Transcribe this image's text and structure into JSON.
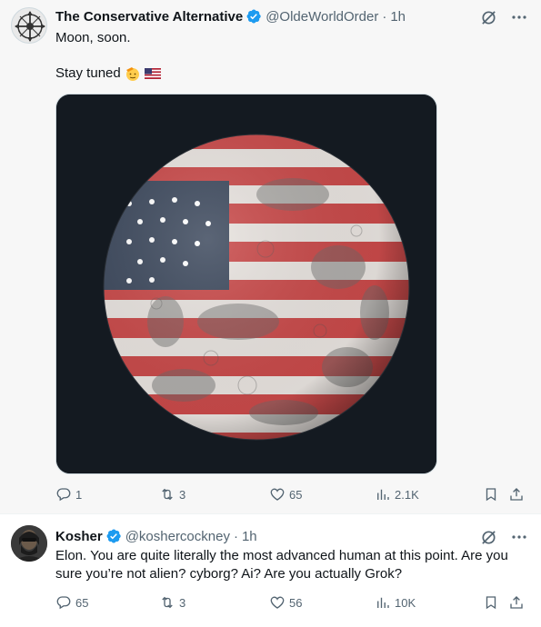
{
  "tweets": [
    {
      "display_name": "The Conservative Alternative",
      "handle": "@OldeWorldOrder",
      "separator": "·",
      "time": "1h",
      "text_line1": "Moon, soon.",
      "text_line2": "Stay tuned",
      "emojis": [
        "saluting-face",
        "us-flag"
      ],
      "stats": {
        "replies": "1",
        "reposts": "3",
        "likes": "65",
        "views": "2.1K"
      }
    },
    {
      "display_name": "Kosher",
      "handle": "@koshercockney",
      "separator": "·",
      "time": "1h",
      "text": "Elon. You are quite literally the most advanced human at this point. Are you sure you’re not alien? cyborg? Ai? Are you actually Grok?",
      "stats": {
        "replies": "65",
        "reposts": "3",
        "likes": "56",
        "views": "10K"
      }
    }
  ],
  "colors": {
    "verified": "#1d9bf0",
    "secondary_text": "#536471",
    "primary_text": "#0f1419"
  },
  "icons": [
    "verified-badge-icon",
    "grok-icon",
    "more-icon",
    "reply-icon",
    "repost-icon",
    "like-icon",
    "views-icon",
    "bookmark-icon",
    "share-icon"
  ]
}
